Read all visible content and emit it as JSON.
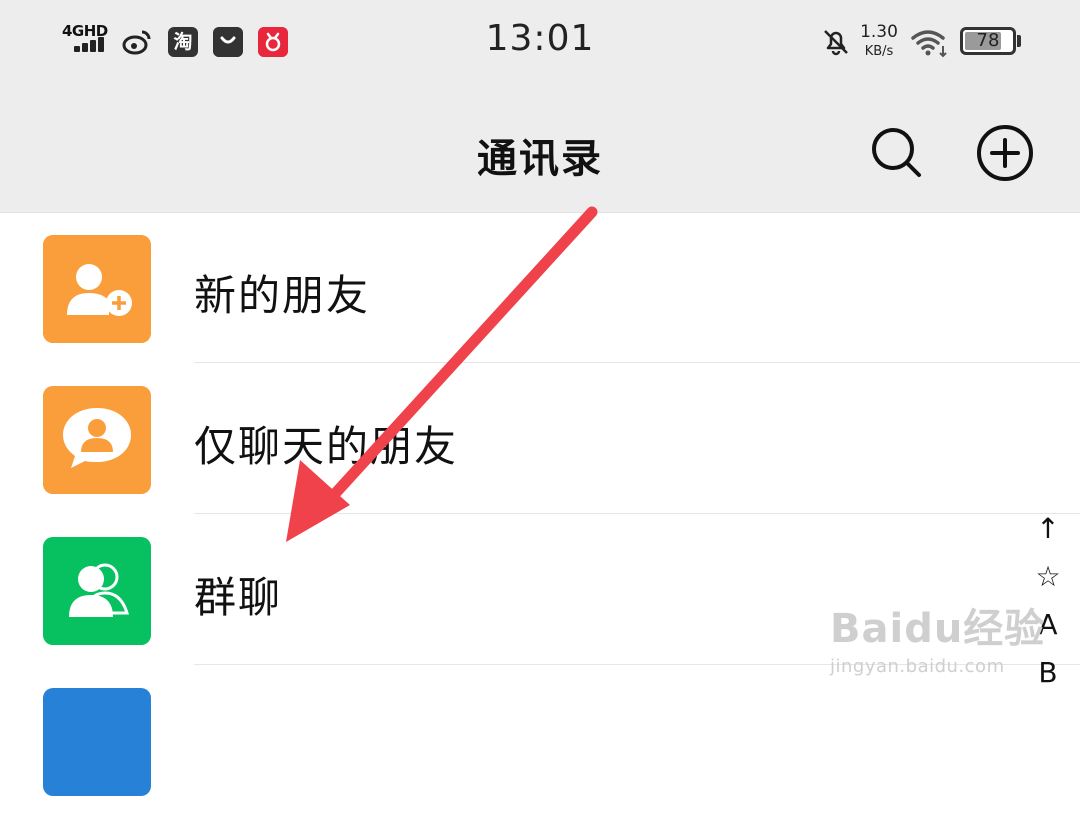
{
  "status_bar": {
    "network": "4GHD",
    "time": "13:01",
    "speed_value": "1.30",
    "speed_unit": "KB/s",
    "battery": "78",
    "battery_level": 0.78,
    "apps": [
      "weibo-icon",
      "taobao-icon",
      "bag-icon",
      "red-app-icon"
    ],
    "taobao_glyph": "淘"
  },
  "header": {
    "title": "通讯录"
  },
  "rows": [
    {
      "label": "新的朋友",
      "icon": "add-friend-icon",
      "color": "#fa9d3b"
    },
    {
      "label": "仅聊天的朋友",
      "icon": "chat-only-friend-icon",
      "color": "#fa9d3b"
    },
    {
      "label": "群聊",
      "icon": "group-chat-icon",
      "color": "#07c160"
    },
    {
      "label": "",
      "icon": "tag-icon",
      "color": "#2782d7"
    }
  ],
  "index_bar": [
    "↑",
    "☆",
    "A",
    "B"
  ],
  "annotation": {
    "arrow_color": "#f0424b"
  },
  "watermark": {
    "main": "Baidu经验",
    "sub": "jingyan.baidu.com"
  }
}
